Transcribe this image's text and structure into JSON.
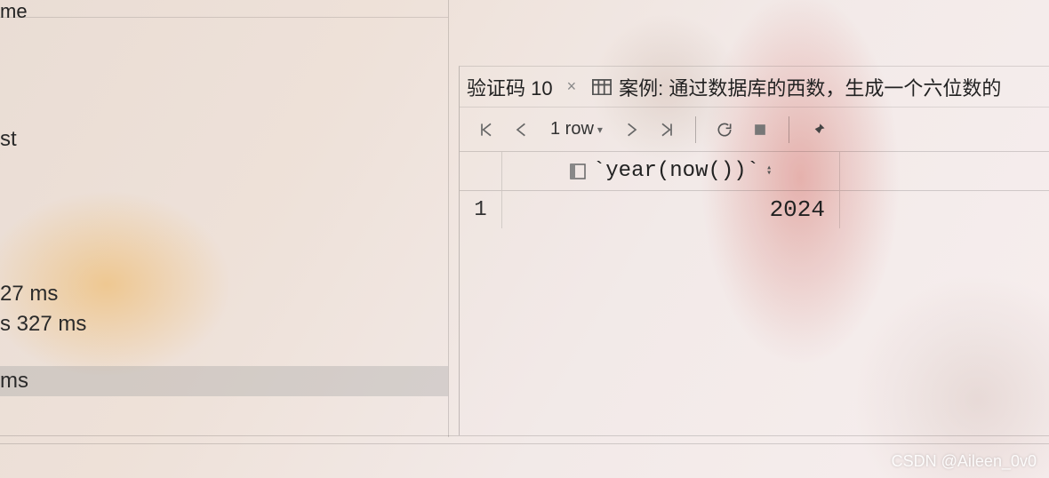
{
  "left": {
    "header_fragment": "me",
    "item_st": "st",
    "time_a": "27 ms",
    "time_b": "s 327 ms",
    "time_sel": " ms"
  },
  "tabs": {
    "tab1_label": "验证码 10",
    "tab2_label": "案例: 通过数据库的西数，生成一个六位数的"
  },
  "toolbar": {
    "row_count": "1 row"
  },
  "grid": {
    "column_header": "`year(now())`",
    "rows": [
      {
        "n": "1",
        "value": "2024"
      }
    ]
  },
  "watermark": "CSDN @Aileen_0v0"
}
